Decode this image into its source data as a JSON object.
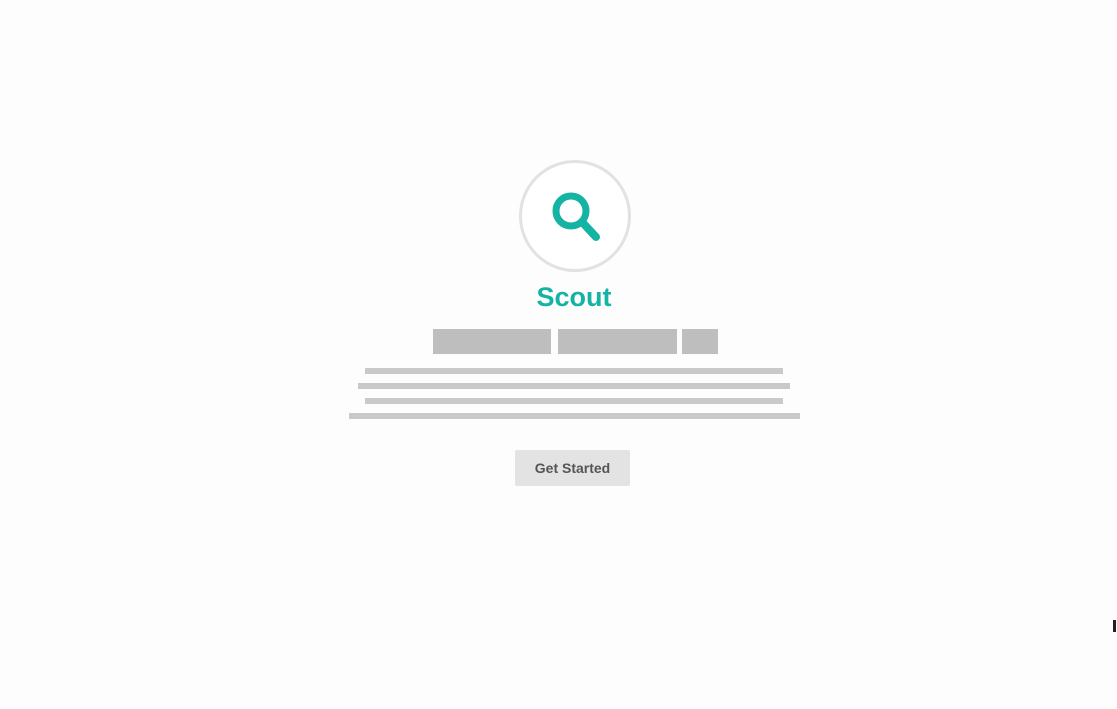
{
  "app": {
    "title": "Scout",
    "logo_icon": "search-icon",
    "accent_color": "#14b3a3"
  },
  "cta": {
    "label": "Get Started"
  }
}
